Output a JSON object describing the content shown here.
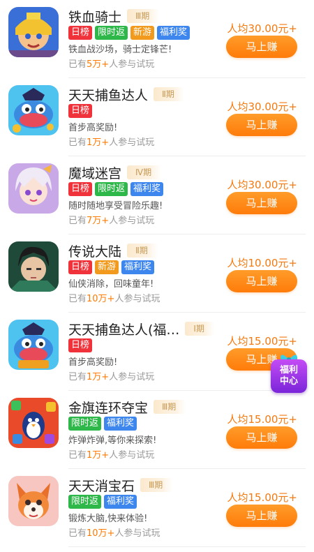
{
  "items": [
    {
      "title": "铁血骑士",
      "period": "Ⅲ期",
      "tags": [
        {
          "label": "日榜",
          "color": "red"
        },
        {
          "label": "限时返",
          "color": "green"
        },
        {
          "label": "新游",
          "color": "orange"
        },
        {
          "label": "福利奖",
          "color": "blue"
        }
      ],
      "desc": "铁血战沙场，骑士定锋芒!",
      "count_prefix": "已有",
      "count_value": "5万+",
      "count_suffix": "人参与试玩",
      "price": "人均30.00元+",
      "button": "马上赚",
      "icon": "knight-game-icon"
    },
    {
      "title": "天天捕鱼达人",
      "period": "Ⅱ期",
      "tags": [
        {
          "label": "日榜",
          "color": "red"
        }
      ],
      "desc": "首步高奖励!",
      "count_prefix": "已有",
      "count_value": "1万+",
      "count_suffix": "人参与试玩",
      "price": "人均30.00元+",
      "button": "马上赚",
      "icon": "fish-game-icon"
    },
    {
      "title": "魔域迷宫",
      "period": "Ⅳ期",
      "tags": [
        {
          "label": "日榜",
          "color": "red"
        },
        {
          "label": "限时返",
          "color": "green"
        },
        {
          "label": "福利奖",
          "color": "blue"
        }
      ],
      "desc": "随时随地享受冒险乐趣!",
      "count_prefix": "已有",
      "count_value": "7万+",
      "count_suffix": "人参与试玩",
      "price": "人均30.00元+",
      "button": "马上赚",
      "icon": "anime-girl-game-icon"
    },
    {
      "title": "传说大陆",
      "period": "Ⅱ期",
      "tags": [
        {
          "label": "日榜",
          "color": "red"
        },
        {
          "label": "新游",
          "color": "orange"
        },
        {
          "label": "福利奖",
          "color": "blue"
        }
      ],
      "desc": "仙侠消除，回味童年!",
      "count_prefix": "已有",
      "count_value": "10万+",
      "count_suffix": "人参与试玩",
      "price": "人均10.00元+",
      "button": "马上赚",
      "icon": "xianxia-hero-game-icon"
    },
    {
      "title": "天天捕鱼达人(福…",
      "period": "Ⅰ期",
      "tags": [
        {
          "label": "日榜",
          "color": "red"
        }
      ],
      "desc": "首步高奖励!",
      "count_prefix": "已有",
      "count_value": "1万+",
      "count_suffix": "人参与试玩",
      "price": "人均15.00元+",
      "button": "马上赚",
      "icon": "fish-game-icon"
    },
    {
      "title": "金旗连环夺宝",
      "period": "Ⅲ期",
      "tags": [
        {
          "label": "限时返",
          "color": "green"
        },
        {
          "label": "福利奖",
          "color": "blue"
        }
      ],
      "desc": "炸弹炸弹,等你来探索!",
      "count_prefix": "已有",
      "count_value": "1万+",
      "count_suffix": "人参与试玩",
      "price": "人均15.00元+",
      "button": "马上赚",
      "icon": "penguin-puzzle-game-icon"
    },
    {
      "title": "天天消宝石",
      "period": "Ⅲ期",
      "tags": [
        {
          "label": "限时返",
          "color": "green"
        },
        {
          "label": "福利奖",
          "color": "blue"
        }
      ],
      "desc": "锻炼大脑,快来体验!",
      "count_prefix": "已有",
      "count_value": "10万+",
      "count_suffix": "人参与试玩",
      "price": "人均15.00元+",
      "button": "马上赚",
      "icon": "fox-gem-game-icon"
    }
  ],
  "float_badge": {
    "label_line1": "福利",
    "label_line2": "中心"
  }
}
